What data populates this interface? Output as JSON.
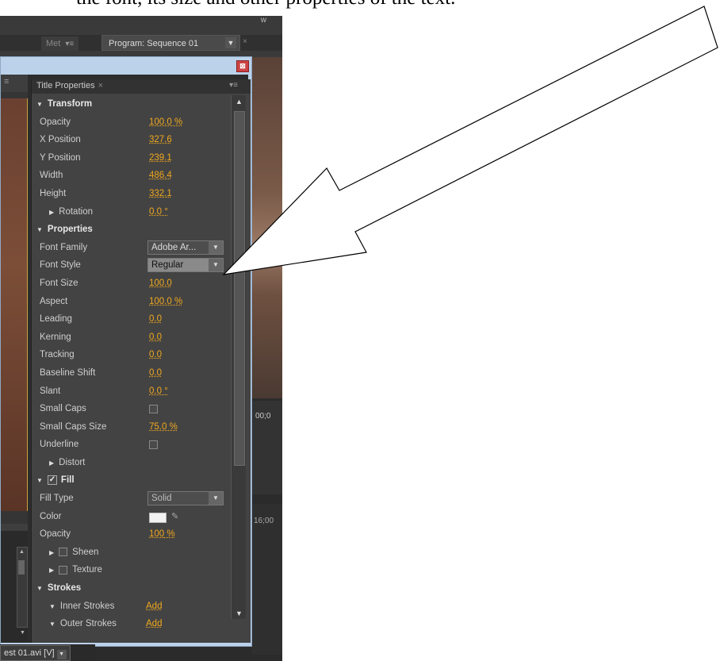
{
  "caption": "the font, its size and other properties of the text.",
  "topbar": {
    "right_text": "w",
    "meta_tab": "Met",
    "meta_menu": "▾≡",
    "program_tab": "Program: Sequence 01",
    "program_dropdown": "▼",
    "program_close": "×"
  },
  "background": {
    "timecode": "00;0",
    "timecode2": "16;00"
  },
  "window": {
    "close_glyph": "⊠"
  },
  "panel": {
    "title": "Title Properties",
    "close": "×",
    "menu": "▾≡",
    "rows": [
      {
        "type": "hdr",
        "label": "Transform",
        "indent": 10
      },
      {
        "type": "val",
        "label": "Opacity",
        "value": "100.0",
        "unit": " %"
      },
      {
        "type": "val",
        "label": "X Position",
        "value": "327.6",
        "unit": ""
      },
      {
        "type": "val",
        "label": "Y Position",
        "value": "239.1",
        "unit": ""
      },
      {
        "type": "val",
        "label": "Width",
        "value": "486.4",
        "unit": ""
      },
      {
        "type": "val",
        "label": "Height",
        "value": "332.1",
        "unit": ""
      },
      {
        "type": "sub",
        "label": "Rotation",
        "value": "0.0",
        "unit": " °"
      },
      {
        "type": "hdr",
        "label": "Properties",
        "indent": 10
      },
      {
        "type": "dd",
        "label": "Font Family",
        "value": "Adobe Ar...",
        "style": "dark"
      },
      {
        "type": "dd",
        "label": "Font Style",
        "value": "Regular",
        "style": "light"
      },
      {
        "type": "val",
        "label": "Font Size",
        "value": "100.0",
        "unit": ""
      },
      {
        "type": "val",
        "label": "Aspect",
        "value": "100.0",
        "unit": " %"
      },
      {
        "type": "val",
        "label": "Leading",
        "value": "0.0",
        "unit": ""
      },
      {
        "type": "val",
        "label": "Kerning",
        "value": "0.0",
        "unit": ""
      },
      {
        "type": "val",
        "label": "Tracking",
        "value": "0.0",
        "unit": ""
      },
      {
        "type": "val",
        "label": "Baseline Shift",
        "value": "0.0",
        "unit": ""
      },
      {
        "type": "val",
        "label": "Slant",
        "value": "0.0",
        "unit": " °"
      },
      {
        "type": "chk",
        "label": "Small Caps"
      },
      {
        "type": "val",
        "label": "Small Caps Size",
        "value": "75.0",
        "unit": " %"
      },
      {
        "type": "chk",
        "label": "Underline"
      },
      {
        "type": "collapsed",
        "label": "Distort"
      },
      {
        "type": "hdrchk",
        "label": "Fill"
      },
      {
        "type": "dd",
        "label": "Fill Type",
        "value": "Solid",
        "style": "solid"
      },
      {
        "type": "color",
        "label": "Color"
      },
      {
        "type": "val",
        "label": "Opacity",
        "value": "100",
        "unit": " %"
      },
      {
        "type": "collchk",
        "label": "Sheen"
      },
      {
        "type": "collchk",
        "label": "Texture"
      },
      {
        "type": "hdr",
        "label": "Strokes",
        "indent": 10
      },
      {
        "type": "subexp",
        "label": "Inner Strokes",
        "value": "Add"
      },
      {
        "type": "subexp",
        "label": "Outer Strokes",
        "value": "Add"
      }
    ]
  },
  "clip_tab": {
    "label": "est 01.avi [V]",
    "dropdown": "▼"
  },
  "colors": {
    "accent": "#f0a81e",
    "panel_bg": "#434343",
    "window_frame": "#bcd2ea"
  },
  "icons": [
    "close-icon",
    "menu-icon",
    "dropdown-arrow-icon",
    "eyedropper-icon",
    "checkbox-icon",
    "scroll-up-icon",
    "scroll-down-icon",
    "callout-arrow"
  ]
}
